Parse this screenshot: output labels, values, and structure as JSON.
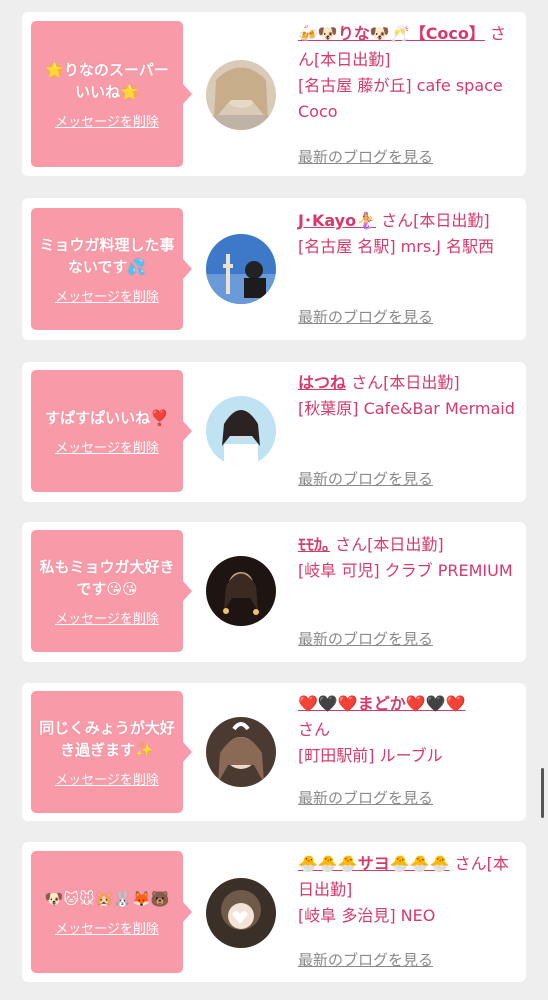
{
  "cards": [
    {
      "message": "🌟りなのスーパーいいね🌟",
      "delete_label": "メッセージを削除",
      "name": "🍻🐶りな🐶🥂【Coco】",
      "san": "さん",
      "status": "[本日出勤]",
      "shop": "[名古屋 藤が丘] cafe space Coco",
      "blog_label": "最新のブログを見る"
    },
    {
      "message": "ミョウガ料理した事ないです💦",
      "delete_label": "メッセージを削除",
      "name": "J･Kayo🧜‍♀️",
      "san": "さん",
      "status": "[本日出勤]",
      "shop": "[名古屋 名駅] mrs.J 名駅西",
      "blog_label": "最新のブログを見る"
    },
    {
      "message": "すぱすぱいいね❣️",
      "delete_label": "メッセージを削除",
      "name": "はつね",
      "san": "さん",
      "status": "[本日出勤]",
      "shop": "[秋葉原] Cafe&Bar Mermaid",
      "blog_label": "最新のブログを見る"
    },
    {
      "message": "私もミョウガ大好きです😘😘",
      "delete_label": "メッセージを削除",
      "name": "ﾓﾓｶ｡",
      "san": "さん",
      "status": "[本日出勤]",
      "shop": "[岐阜 可児] クラブ PREMIUM",
      "blog_label": "最新のブログを見る"
    },
    {
      "message": "同じくみょうが大好き過ぎます✨",
      "delete_label": "メッセージを削除",
      "name": "❤️🖤❤️まどか❤️🖤❤️",
      "san": "さん",
      "status": "",
      "shop": "[町田駅前] ルーブル",
      "blog_label": "最新のブログを見る"
    },
    {
      "message": "🐶🐱🐭🐹🐰🦊🐻",
      "delete_label": "メッセージを削除",
      "name": "🐣🐣🐣サヨ🐣🐣🐣",
      "san": "さん",
      "status": "[本日出勤]",
      "shop": "[岐阜 多治見] NEO",
      "blog_label": "最新のブログを見る"
    }
  ],
  "colors": {
    "bubble": "#f99aa8",
    "accent": "#d63a6a",
    "muted": "#8a8a8a"
  }
}
